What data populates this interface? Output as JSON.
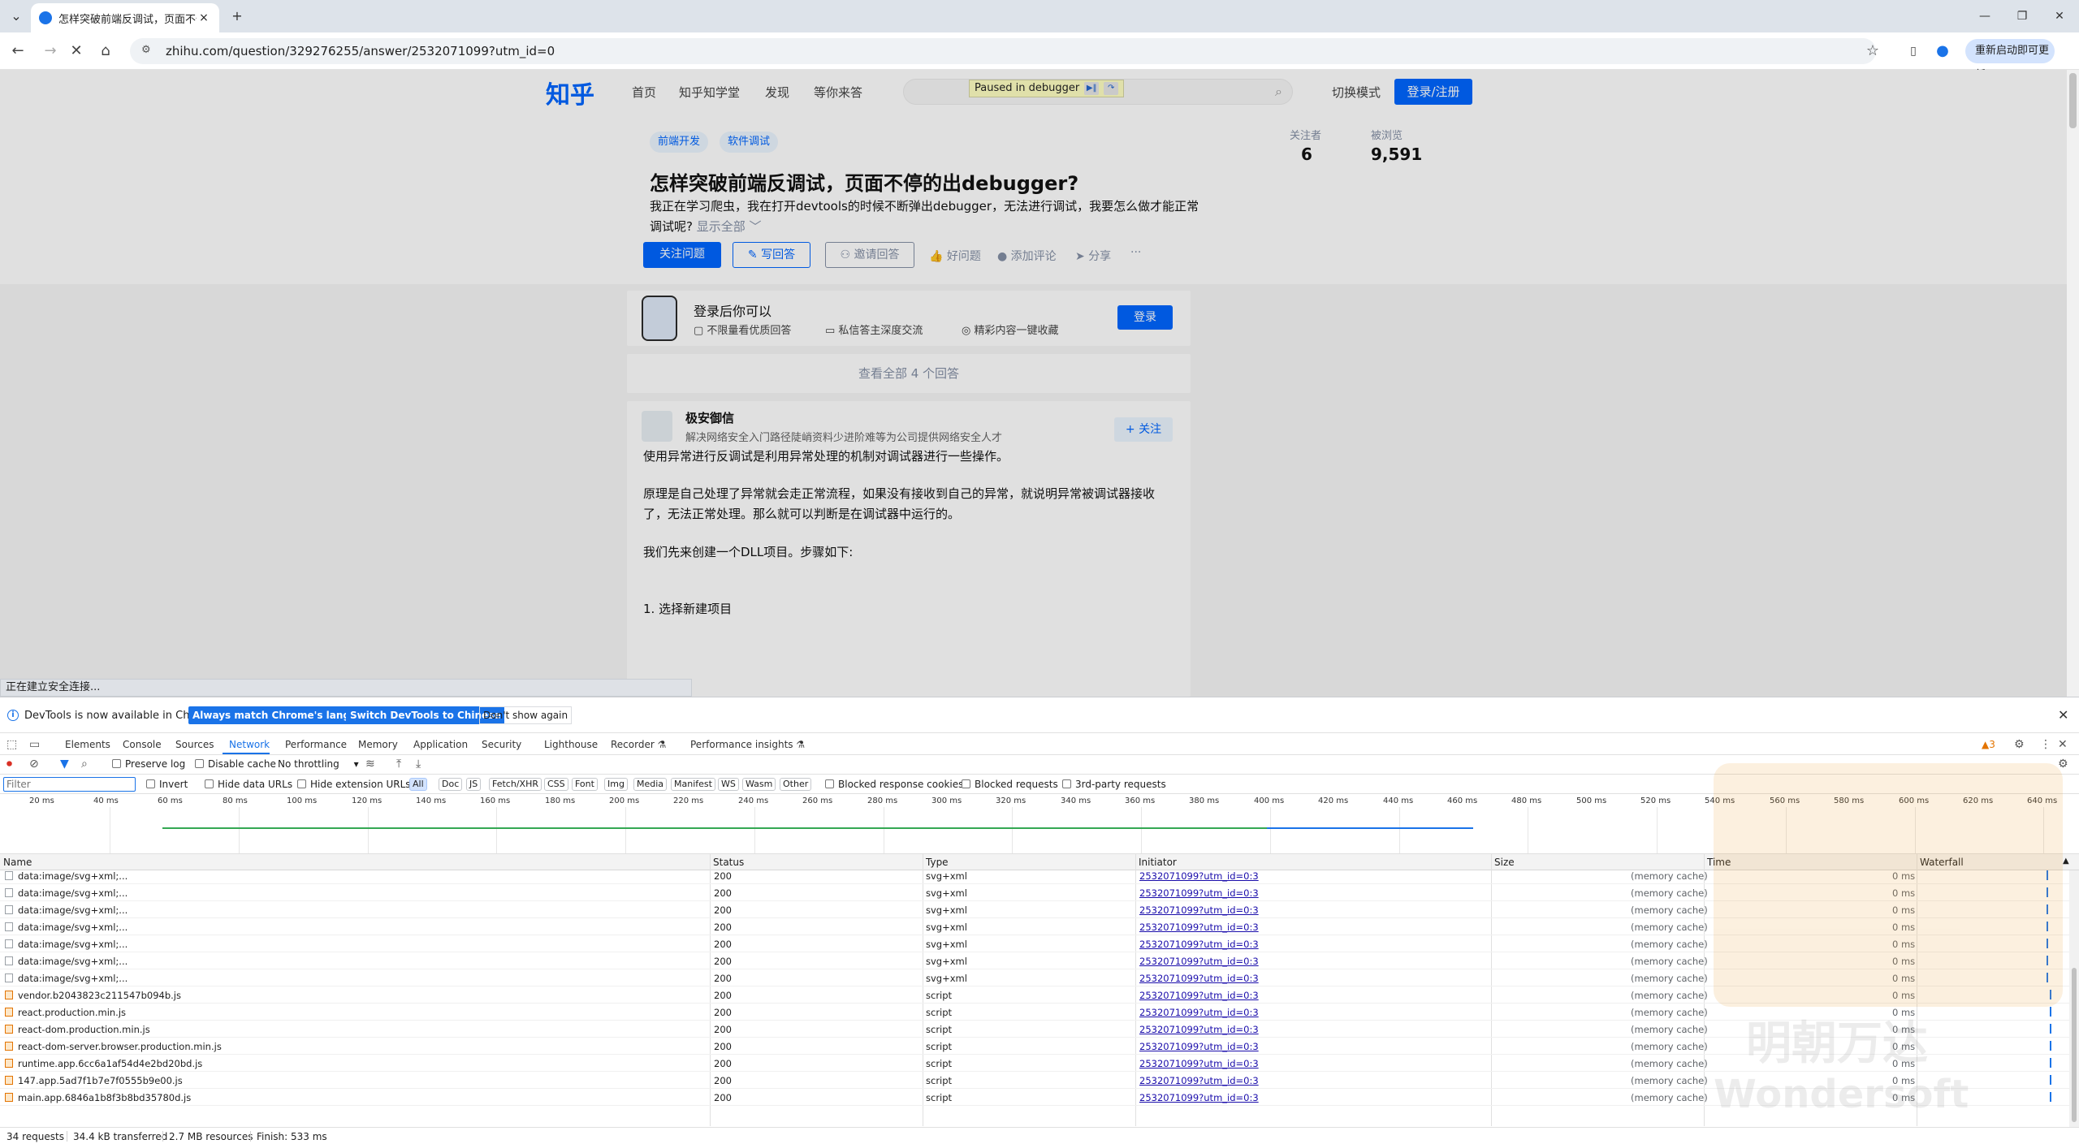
{
  "browser": {
    "tab_title": "怎样突破前端反调试，页面不停...",
    "tab_close": "×",
    "new_tab": "+",
    "url": "zhihu.com/question/329276255/answer/2532071099?utm_id=0",
    "update_button": "重新启动即可更新",
    "icons": [
      "tab-list-icon",
      "back-icon",
      "forward-icon",
      "stop-icon",
      "home-icon",
      "site-info-icon",
      "bookmark-star-icon",
      "side-panel-icon",
      "profile-icon",
      "menu-icon",
      "minimize-icon",
      "maximize-icon",
      "close-icon"
    ]
  },
  "page": {
    "logo": "知乎",
    "nav": [
      "首页",
      "知乎知学堂",
      "发现",
      "等你来答"
    ],
    "debugger_pill": "Paused in debugger",
    "mode_switch": "切换模式",
    "login_register": "登录/注册",
    "topics": [
      "前端开发",
      "软件调试"
    ],
    "question_title": "怎样突破前端反调试，页面不停的出debugger?",
    "question_desc": "我正在学习爬虫，我在打开devtools的时候不断弹出debugger，无法进行调试，我要怎么做才能正常调试呢?",
    "show_all": "显示全部 ﹀",
    "followers_label": "关注者",
    "followers_value": "6",
    "views_label": "被浏览",
    "views_value": "9,591",
    "actions": {
      "follow_question": "关注问题",
      "write_answer": "✎ 写回答",
      "invite": "邀请回答",
      "good_question": "好问题",
      "add_comment": "添加评论",
      "share": "分享",
      "more": "···"
    },
    "login_card": {
      "title": "登录后你可以",
      "features": [
        "不限量看优质回答",
        "私信答主深度交流",
        "精彩内容一键收藏"
      ],
      "button": "登录"
    },
    "all_answers": "查看全部 4 个回答",
    "answer": {
      "author": "极安御信",
      "bio": "解决网络安全入门路径陡峭资料少进阶难等为公司提供网络安全人才",
      "follow": "+ 关注",
      "paragraphs": [
        "使用异常进行反调试是利用异常处理的机制对调试器进行一些操作。",
        "原理是自己处理了异常就会走正常流程，如果没有接收到自己的异常，就说明异常被调试器接收了，无法正常处理。那么就可以判断是在调试器中运行的。",
        "我们先来创建一个DLL项目。步骤如下:",
        "1. 选择新建项目"
      ]
    },
    "status_text": "正在建立安全连接..."
  },
  "devtools": {
    "info_text": "DevTools is now available in Chinese!",
    "btn_match": "Always match Chrome's language",
    "btn_switch": "Switch DevTools to Chinese",
    "btn_dont_show": "Don't show again",
    "tabs": [
      "Elements",
      "Console",
      "Sources",
      "Network",
      "Performance",
      "Memory",
      "Application",
      "Security",
      "Lighthouse",
      "Recorder ⚗",
      "Performance insights ⚗"
    ],
    "active_tab": "Network",
    "issues_count": "3",
    "toolbar": {
      "preserve_log": "Preserve log",
      "disable_cache": "Disable cache",
      "throttling": "No throttling"
    },
    "filter_placeholder": "Filter",
    "filter_options": [
      "Invert",
      "Hide data URLs",
      "Hide extension URLs"
    ],
    "type_chips": [
      "All",
      "Doc",
      "JS",
      "Fetch/XHR",
      "CSS",
      "Font",
      "Img",
      "Media",
      "Manifest",
      "WS",
      "Wasm",
      "Other"
    ],
    "extra_filters": [
      "Blocked response cookies",
      "Blocked requests",
      "3rd-party requests"
    ],
    "timeline_ticks": [
      "20 ms",
      "40 ms",
      "60 ms",
      "80 ms",
      "100 ms",
      "120 ms",
      "140 ms",
      "160 ms",
      "180 ms",
      "200 ms",
      "220 ms",
      "240 ms",
      "260 ms",
      "280 ms",
      "300 ms",
      "320 ms",
      "340 ms",
      "360 ms",
      "380 ms",
      "400 ms",
      "420 ms",
      "440 ms",
      "460 ms",
      "480 ms",
      "500 ms",
      "520 ms",
      "540 ms",
      "560 ms",
      "580 ms",
      "600 ms",
      "620 ms",
      "640 ms"
    ],
    "columns": [
      "Name",
      "Status",
      "Type",
      "Initiator",
      "Size",
      "Time",
      "Waterfall"
    ],
    "rows": [
      {
        "name": "data:image/svg+xml;...",
        "status": "200",
        "type": "svg+xml",
        "initiator": "2532071099?utm_id=0:3",
        "size": "(memory cache)",
        "time": "0 ms",
        "kind": "img"
      },
      {
        "name": "data:image/svg+xml;...",
        "status": "200",
        "type": "svg+xml",
        "initiator": "2532071099?utm_id=0:3",
        "size": "(memory cache)",
        "time": "0 ms",
        "kind": "img"
      },
      {
        "name": "data:image/svg+xml;...",
        "status": "200",
        "type": "svg+xml",
        "initiator": "2532071099?utm_id=0:3",
        "size": "(memory cache)",
        "time": "0 ms",
        "kind": "img"
      },
      {
        "name": "data:image/svg+xml;...",
        "status": "200",
        "type": "svg+xml",
        "initiator": "2532071099?utm_id=0:3",
        "size": "(memory cache)",
        "time": "0 ms",
        "kind": "img"
      },
      {
        "name": "data:image/svg+xml;...",
        "status": "200",
        "type": "svg+xml",
        "initiator": "2532071099?utm_id=0:3",
        "size": "(memory cache)",
        "time": "0 ms",
        "kind": "img"
      },
      {
        "name": "data:image/svg+xml;...",
        "status": "200",
        "type": "svg+xml",
        "initiator": "2532071099?utm_id=0:3",
        "size": "(memory cache)",
        "time": "0 ms",
        "kind": "img"
      },
      {
        "name": "data:image/svg+xml;...",
        "status": "200",
        "type": "svg+xml",
        "initiator": "2532071099?utm_id=0:3",
        "size": "(memory cache)",
        "time": "0 ms",
        "kind": "img"
      },
      {
        "name": "vendor.b2043823c211547b094b.js",
        "status": "200",
        "type": "script",
        "initiator": "2532071099?utm_id=0:3",
        "size": "(memory cache)",
        "time": "0 ms",
        "kind": "js"
      },
      {
        "name": "react.production.min.js",
        "status": "200",
        "type": "script",
        "initiator": "2532071099?utm_id=0:3",
        "size": "(memory cache)",
        "time": "0 ms",
        "kind": "js"
      },
      {
        "name": "react-dom.production.min.js",
        "status": "200",
        "type": "script",
        "initiator": "2532071099?utm_id=0:3",
        "size": "(memory cache)",
        "time": "0 ms",
        "kind": "js"
      },
      {
        "name": "react-dom-server.browser.production.min.js",
        "status": "200",
        "type": "script",
        "initiator": "2532071099?utm_id=0:3",
        "size": "(memory cache)",
        "time": "0 ms",
        "kind": "js"
      },
      {
        "name": "runtime.app.6cc6a1af54d4e2bd20bd.js",
        "status": "200",
        "type": "script",
        "initiator": "2532071099?utm_id=0:3",
        "size": "(memory cache)",
        "time": "0 ms",
        "kind": "js"
      },
      {
        "name": "147.app.5ad7f1b7e7f0555b9e00.js",
        "status": "200",
        "type": "script",
        "initiator": "2532071099?utm_id=0:3",
        "size": "(memory cache)",
        "time": "0 ms",
        "kind": "js"
      },
      {
        "name": "main.app.6846a1b8f3b8bd35780d.js",
        "status": "200",
        "type": "script",
        "initiator": "2532071099?utm_id=0:3",
        "size": "(memory cache)",
        "time": "0 ms",
        "kind": "js"
      }
    ],
    "summary": {
      "requests": "34 requests",
      "transferred": "34.4 kB transferred",
      "resources": "2.7 MB resources",
      "finish": "Finish: 533 ms"
    }
  },
  "colors": {
    "accent": "#1a73e8",
    "zhihu_blue": "#0066ff",
    "tab_strip": "#dde3ea"
  }
}
